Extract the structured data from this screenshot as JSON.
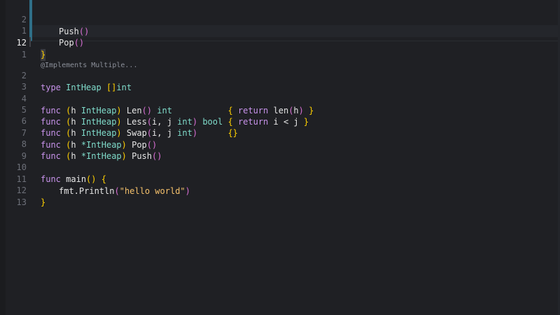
{
  "popup": {
    "lines": [
      {
        "number": "2",
        "text": "Push()"
      },
      {
        "number": "1",
        "text": "Pop()"
      },
      {
        "number": "12",
        "text": "}"
      }
    ]
  },
  "codelens": "@Implements Multiple...",
  "line_numbers": [
    "1",
    "2",
    "3",
    "4",
    "5",
    "6",
    "7",
    "8",
    "9",
    "10",
    "11",
    "12",
    "13"
  ],
  "tokens": {
    "type": "type",
    "func": "func",
    "intheap_decl": "IntHeap",
    "slice_int": "int",
    "recv_h": "h",
    "intheap": "IntHeap",
    "ptr_intheap": "*IntHeap",
    "len": "Len",
    "less": "Less",
    "swap": "Swap",
    "pop": "Pop",
    "push": "Push",
    "int": "int",
    "bool": "bool",
    "return": "return",
    "len_call": "len",
    "params_ij": "i, j",
    "i_lt_j": "i < j",
    "main": "main",
    "fmt_println": "fmt.Println",
    "hello": "\"hello world\""
  }
}
